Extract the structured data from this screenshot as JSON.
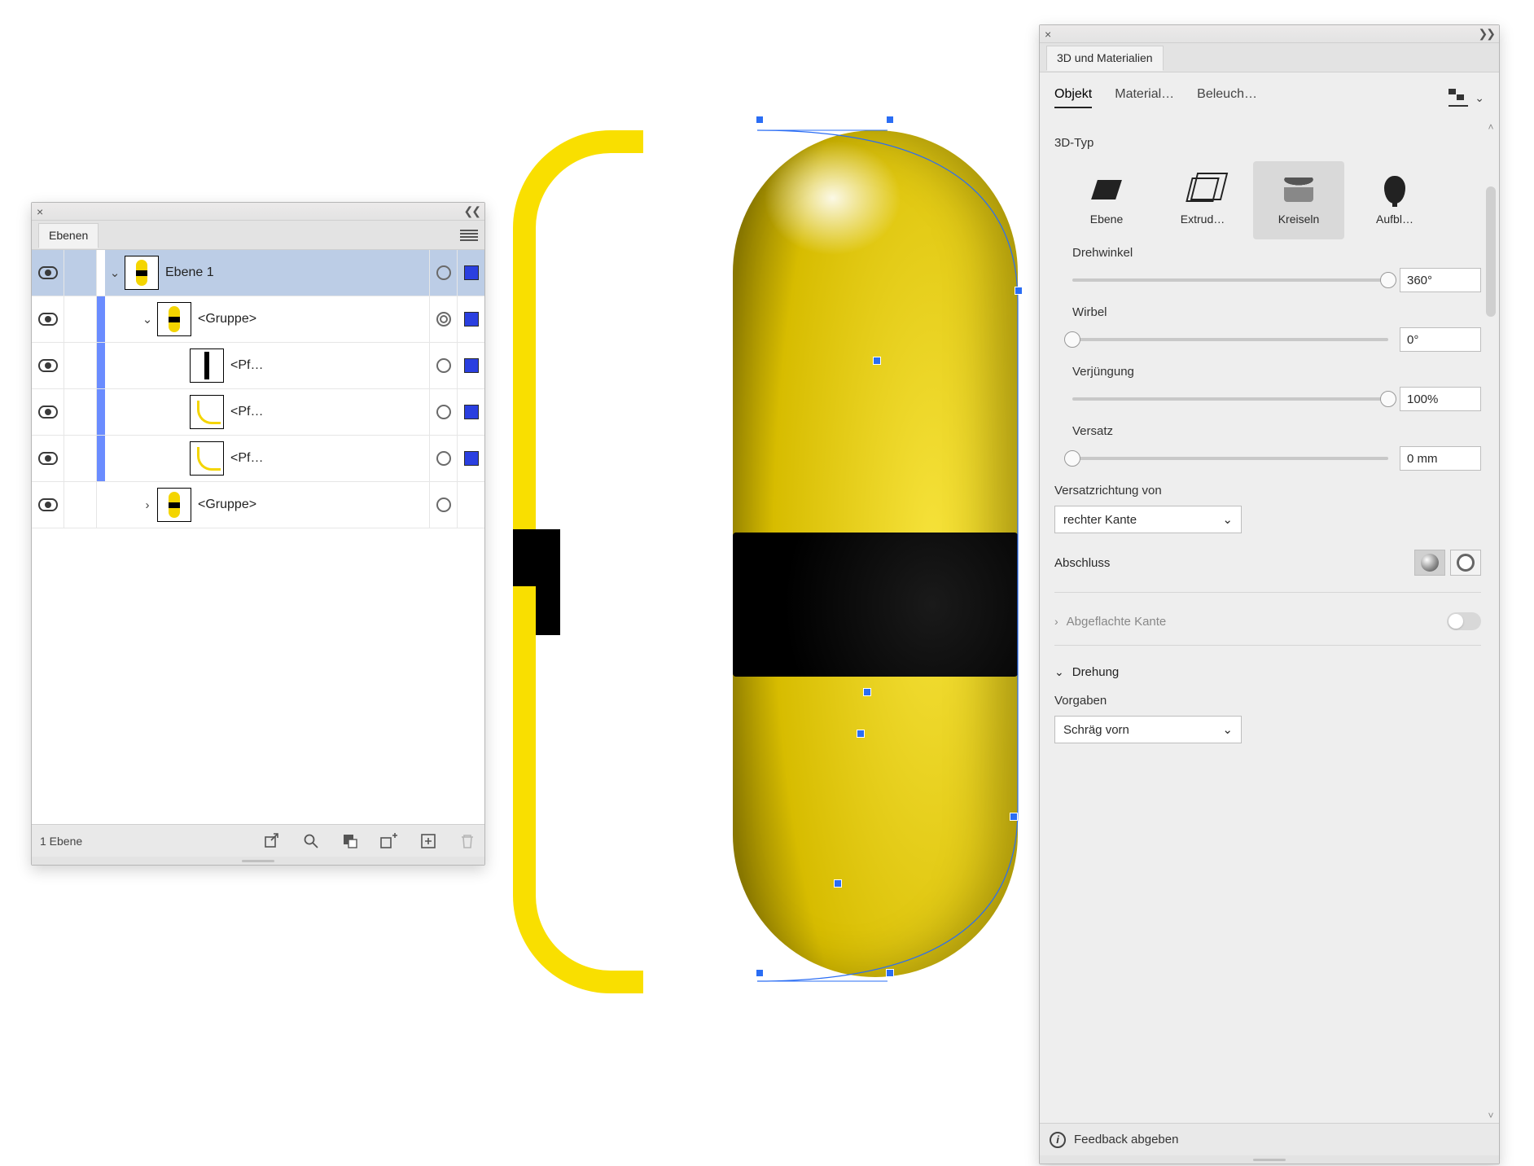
{
  "layers": {
    "tab_label": "Ebenen",
    "footer_text": "1 Ebene",
    "rows": [
      {
        "name": "Ebene 1",
        "indent": 0,
        "thumb": "pill",
        "expand": "open",
        "selected": true,
        "ring": "single",
        "swatch": true,
        "edge": false
      },
      {
        "name": "<Gruppe>",
        "indent": 1,
        "thumb": "pill",
        "expand": "open",
        "selected": false,
        "ring": "double",
        "swatch": true,
        "edge": true
      },
      {
        "name": "<Pf…",
        "indent": 2,
        "thumb": "bw",
        "expand": "none",
        "selected": false,
        "ring": "single",
        "swatch": true,
        "edge": true
      },
      {
        "name": "<Pf…",
        "indent": 2,
        "thumb": "curve",
        "expand": "none",
        "selected": false,
        "ring": "single",
        "swatch": true,
        "edge": true
      },
      {
        "name": "<Pf…",
        "indent": 2,
        "thumb": "curve",
        "expand": "none",
        "selected": false,
        "ring": "single",
        "swatch": true,
        "edge": true
      },
      {
        "name": "<Gruppe>",
        "indent": 1,
        "thumb": "pill",
        "expand": "closed",
        "selected": false,
        "ring": "single",
        "swatch": false,
        "edge": false
      }
    ]
  },
  "panel3d": {
    "title": "3D und Materialien",
    "subtabs": {
      "objekt": "Objekt",
      "material": "Material…",
      "beleuch": "Beleuch…"
    },
    "type_label": "3D-Typ",
    "types": {
      "ebene": "Ebene",
      "extrude": "Extrud…",
      "kreiseln": "Kreiseln",
      "aufblasen": "Aufbl…"
    },
    "controls": {
      "drehwinkel": {
        "label": "Drehwinkel",
        "value": "360°",
        "pos": 1.0
      },
      "wirbel": {
        "label": "Wirbel",
        "value": "0°",
        "pos": 0.0
      },
      "verjuengung": {
        "label": "Verjüngung",
        "value": "100%",
        "pos": 1.0
      },
      "versatz": {
        "label": "Versatz",
        "value": "0 mm",
        "pos": 0.0
      }
    },
    "versatzrichtung": {
      "label": "Versatzrichtung von",
      "value": "rechter Kante"
    },
    "abschluss_label": "Abschluss",
    "abgeflacht": "Abgeflachte Kante",
    "drehung": "Drehung",
    "vorgaben": {
      "label": "Vorgaben",
      "value": "Schräg vorn"
    },
    "feedback": "Feedback abgeben"
  }
}
